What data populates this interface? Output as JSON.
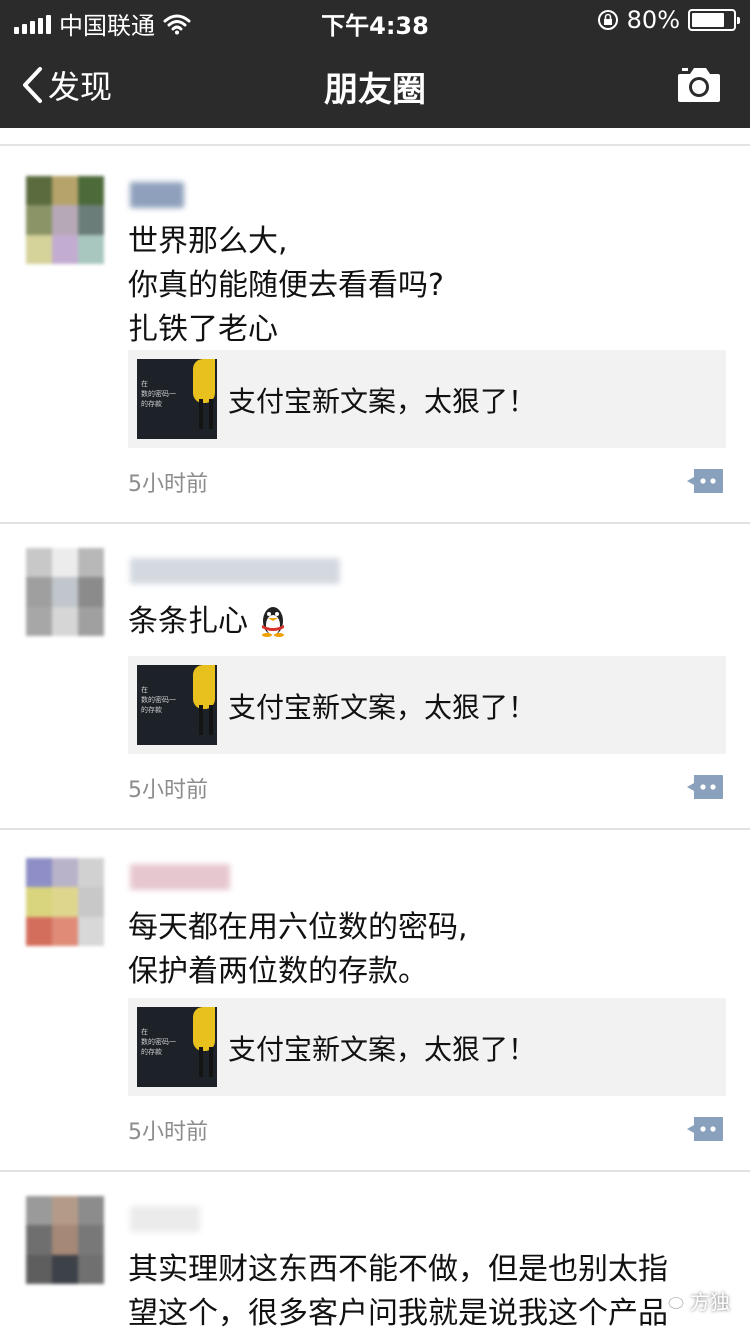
{
  "status_bar": {
    "carrier": "中国联通",
    "time": "下午4:38",
    "battery": "80%",
    "battery_level": 0.8
  },
  "nav": {
    "back_label": "发现",
    "title": "朋友圈",
    "camera_icon": "camera-icon"
  },
  "posts": [
    {
      "lines": [
        "世界那么大,",
        "你真的能随便去看看吗?",
        "扎铁了老心"
      ],
      "link_title": "支付宝新文案，太狠了！",
      "thumb_text": [
        "在",
        "数的密码一",
        "的存款"
      ],
      "time": "5小时前"
    },
    {
      "lines": [
        "条条扎心"
      ],
      "link_title": "支付宝新文案，太狠了！",
      "thumb_text": [
        "在",
        "数的密码一",
        "的存款"
      ],
      "time": "5小时前"
    },
    {
      "lines": [
        "每天都在用六位数的密码,",
        "保护着两位数的存款。"
      ],
      "link_title": "支付宝新文案，太狠了！",
      "thumb_text": [
        "在",
        "数的密码一",
        "的存款"
      ],
      "time": "5小时前"
    },
    {
      "lines": [
        "其实理财这东西不能不做，但是也别太指",
        "望这个，很多客户问我就是说我这个产品"
      ]
    }
  ],
  "watermark": "方独",
  "colors": {
    "bar_bg": "#2b2b2b",
    "card_bg": "#f2f2f2",
    "time_text": "#8c8c8c",
    "comment_icon": "#8aa1bd"
  }
}
